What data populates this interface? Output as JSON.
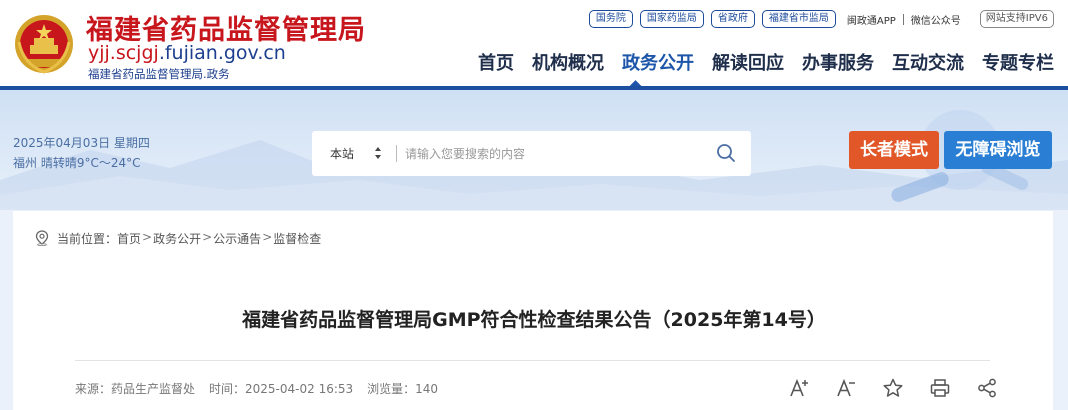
{
  "header": {
    "title": "福建省药品监督管理局",
    "domain_prefix": "yjj.scjgj",
    "domain_suffix": ".fujian.gov.cn",
    "subtitle": "福建省药品监督管理局.政务",
    "top_links": [
      "国务院",
      "国家药监局",
      "省政府",
      "福建省市监局"
    ],
    "app_link": "闽政通APP",
    "wechat_link": "微信公众号",
    "ipv6_badge": "网站支持IPV6"
  },
  "nav": {
    "items": [
      {
        "label": "首页"
      },
      {
        "label": "机构概况"
      },
      {
        "label": "政务公开",
        "active": true
      },
      {
        "label": "解读回应"
      },
      {
        "label": "办事服务"
      },
      {
        "label": "互动交流"
      },
      {
        "label": "专题专栏"
      }
    ]
  },
  "banner": {
    "date": "2025年04月03日 星期四",
    "weather": "福州 晴转晴9°C～24°C"
  },
  "search": {
    "scope": "本站",
    "placeholder": "请输入您要搜索的内容"
  },
  "buttons": {
    "elder_mode": "长者模式",
    "accessible": "无障碍浏览"
  },
  "breadcrumb": {
    "prefix": "当前位置：",
    "items": [
      "首页",
      "政务公开",
      "公示通告",
      "监督检查"
    ],
    "separator": ">"
  },
  "article": {
    "title": "福建省药品监督管理局GMP符合性检查结果公告（2025年第14号）",
    "source": "来源：药品生产监督处",
    "time": "时间：2025-04-02 16:53",
    "views": "浏览量：140"
  },
  "colors": {
    "brand_red": "#c8161d",
    "brand_blue": "#1d4fa0",
    "elder_orange": "#e25727",
    "a11y_blue": "#2a7fd4"
  }
}
